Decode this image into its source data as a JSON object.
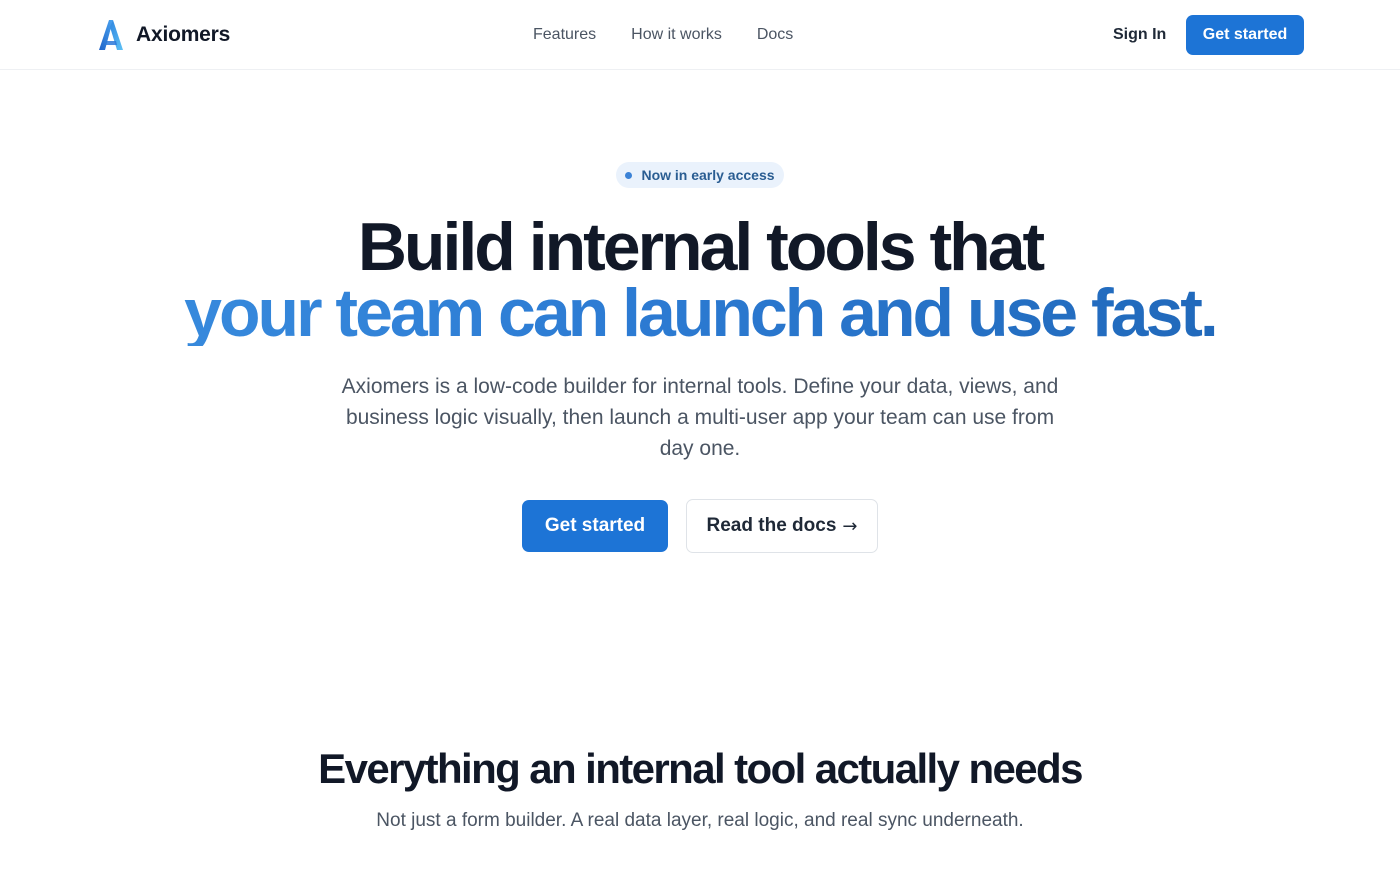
{
  "header": {
    "brand_name": "Axiomers",
    "logo_icon": "axiomers-a-logo-icon",
    "nav": [
      {
        "label": "Features"
      },
      {
        "label": "How it works"
      },
      {
        "label": "Docs"
      }
    ],
    "sign_in_label": "Sign In",
    "cta_label": "Get started"
  },
  "hero": {
    "badge_text": "Now in early access",
    "title_line1": "Build internal tools that",
    "title_line2": "your team can launch and use fast.",
    "subtitle": "Axiomers is a low-code builder for internal tools. Define your data, views, and business logic visually, then launch a multi-user app your team can use from day one.",
    "primary_cta": "Get started",
    "secondary_cta": "Read the docs",
    "secondary_cta_icon": "→"
  },
  "features": {
    "title": "Everything an internal tool actually needs",
    "subtitle": "Not just a form builder. A real data layer, real logic, and real sync underneath."
  },
  "colors": {
    "accent": "#1d74d6",
    "gradient_start": "#3b8fe0",
    "gradient_end": "#1d63b3",
    "badge_bg": "#eaf2fc",
    "heading": "#111827",
    "body_text": "#4b5563"
  }
}
